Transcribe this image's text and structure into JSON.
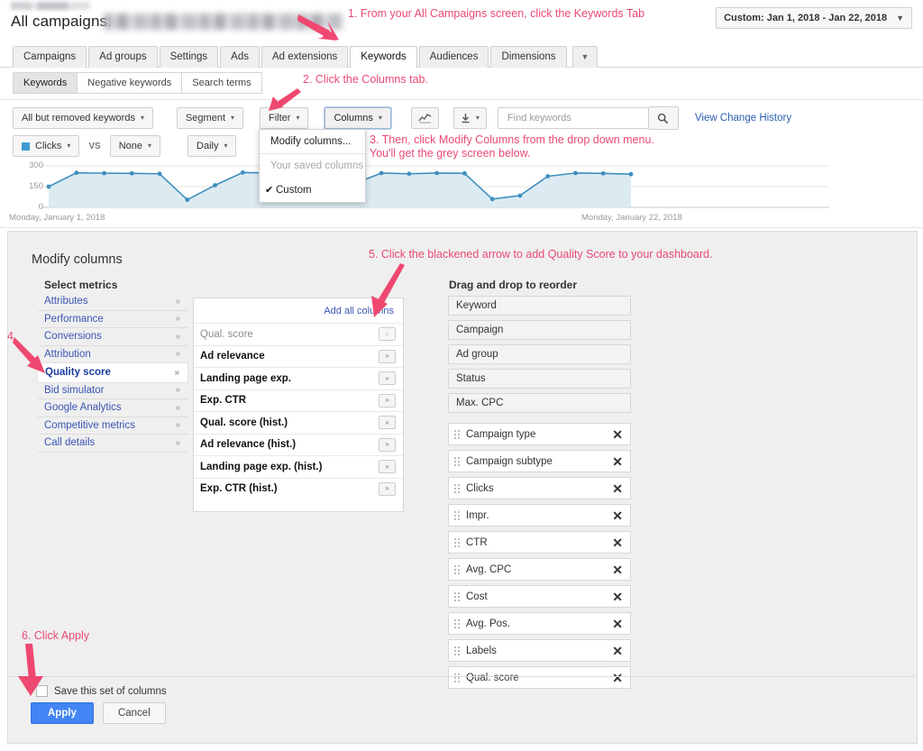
{
  "header": {
    "page_title": "All campaigns:",
    "account_blurred": true,
    "date_range": "Custom: Jan 1, 2018 - Jan 22, 2018",
    "date_caret": "▼"
  },
  "tabs": [
    {
      "label": "Campaigns",
      "active": false
    },
    {
      "label": "Ad groups",
      "active": false
    },
    {
      "label": "Settings",
      "active": false
    },
    {
      "label": "Ads",
      "active": false
    },
    {
      "label": "Ad extensions",
      "active": false
    },
    {
      "label": "Keywords",
      "active": true
    },
    {
      "label": "Audiences",
      "active": false
    },
    {
      "label": "Dimensions",
      "active": false
    }
  ],
  "tabs_more_caret": "▼",
  "subtabs": [
    {
      "label": "Keywords",
      "active": true
    },
    {
      "label": "Negative keywords",
      "active": false
    },
    {
      "label": "Search terms",
      "active": false
    }
  ],
  "toolbar": {
    "filter_scope": "All but removed keywords",
    "segment": "Segment",
    "filter": "Filter",
    "columns": "Columns",
    "chart_icon": "line-chart-icon",
    "download_icon": "download-icon",
    "caret": "▾",
    "search_placeholder": "Find keywords",
    "search_value": "",
    "search_icon": "search-icon",
    "change_history_link": "View Change History"
  },
  "columns_menu": {
    "items": [
      {
        "label": "Modify columns...",
        "disabled": false,
        "checked": false
      },
      {
        "label": "Your saved columns",
        "disabled": true,
        "checked": false
      },
      {
        "label": "Custom",
        "disabled": false,
        "checked": true
      }
    ],
    "check_glyph": "✔"
  },
  "chart_controls": {
    "metric": "Clicks",
    "metric_color": "#3d9ad3",
    "vs": "VS",
    "compare": "None",
    "granularity": "Daily",
    "caret": "▾"
  },
  "chart_data": {
    "type": "line",
    "title": "",
    "xlabel": "",
    "ylabel": "Clicks",
    "ylim": [
      0,
      300
    ],
    "yticks": [
      0,
      150,
      300
    ],
    "ytick_labels": [
      "0",
      "150",
      "300"
    ],
    "x_start_label": "Monday, January 1, 2018",
    "x_end_label": "Monday, January 22, 2018",
    "grid": true,
    "legend": "none",
    "line_color": "#3d8fbf",
    "fill_color": "#dceaf2",
    "x": [
      "Jan 1",
      "Jan 2",
      "Jan 3",
      "Jan 4",
      "Jan 5",
      "Jan 6",
      "Jan 7",
      "Jan 8",
      "Jan 9",
      "Jan 10",
      "Jan 11",
      "Jan 12",
      "Jan 13",
      "Jan 14",
      "Jan 15",
      "Jan 16",
      "Jan 17",
      "Jan 18",
      "Jan 19",
      "Jan 20",
      "Jan 21",
      "Jan 22"
    ],
    "series": [
      {
        "name": "Clicks",
        "values": [
          150,
          250,
          247,
          246,
          243,
          55,
          160,
          252,
          248,
          85,
          85,
          170,
          248,
          243,
          248,
          246,
          60,
          85,
          225,
          248,
          246,
          240
        ]
      }
    ]
  },
  "modal": {
    "title": "Modify columns",
    "select_metrics_label": "Select metrics",
    "categories": [
      {
        "label": "Attributes",
        "selected": false
      },
      {
        "label": "Performance",
        "selected": false
      },
      {
        "label": "Conversions",
        "selected": false
      },
      {
        "label": "Attribution",
        "selected": false
      },
      {
        "label": "Quality score",
        "selected": true
      },
      {
        "label": "Bid simulator",
        "selected": false
      },
      {
        "label": "Google Analytics",
        "selected": false
      },
      {
        "label": "Competitive metrics",
        "selected": false
      },
      {
        "label": "Call details",
        "selected": false
      }
    ],
    "category_arrow": "»",
    "add_all_label": "Add all columns",
    "metrics": [
      {
        "label": "Qual. score",
        "added": true
      },
      {
        "label": "Ad relevance",
        "added": false
      },
      {
        "label": "Landing page exp.",
        "added": false
      },
      {
        "label": "Exp. CTR",
        "added": false
      },
      {
        "label": "Qual. score (hist.)",
        "added": false
      },
      {
        "label": "Ad relevance (hist.)",
        "added": false
      },
      {
        "label": "Landing page exp. (hist.)",
        "added": false
      },
      {
        "label": "Exp. CTR (hist.)",
        "added": false
      }
    ],
    "add_glyph": "»",
    "reorder_label": "Drag and drop to reorder",
    "reorder_items": [
      {
        "label": "Keyword",
        "movable": false
      },
      {
        "label": "Campaign",
        "movable": false
      },
      {
        "label": "Ad group",
        "movable": false
      },
      {
        "label": "Status",
        "movable": false
      },
      {
        "label": "Max. CPC",
        "movable": false
      },
      {
        "label": "Campaign type",
        "movable": true
      },
      {
        "label": "Campaign subtype",
        "movable": true
      },
      {
        "label": "Clicks",
        "movable": true
      },
      {
        "label": "Impr.",
        "movable": true
      },
      {
        "label": "CTR",
        "movable": true
      },
      {
        "label": "Avg. CPC",
        "movable": true
      },
      {
        "label": "Cost",
        "movable": true
      },
      {
        "label": "Avg. Pos.",
        "movable": true
      },
      {
        "label": "Labels",
        "movable": true
      },
      {
        "label": "Qual. score",
        "movable": true
      }
    ],
    "remove_glyph": "✕",
    "save_set_label": "Save this set of columns",
    "save_set_checked": false,
    "apply_label": "Apply",
    "cancel_label": "Cancel"
  },
  "annotations": {
    "color": "#ea4a72",
    "step1": "1. From your All Campaigns screen, click the Keywords Tab",
    "step2": "2. Click the Columns tab.",
    "step3": "3.  Then, click Modify Columns from the drop down menu.\n     You'll get the grey screen below.",
    "step4": "4.",
    "step5": "5. Click the blackened arrow to add Quality Score to your dashboard.",
    "step6": "6. Click Apply"
  }
}
